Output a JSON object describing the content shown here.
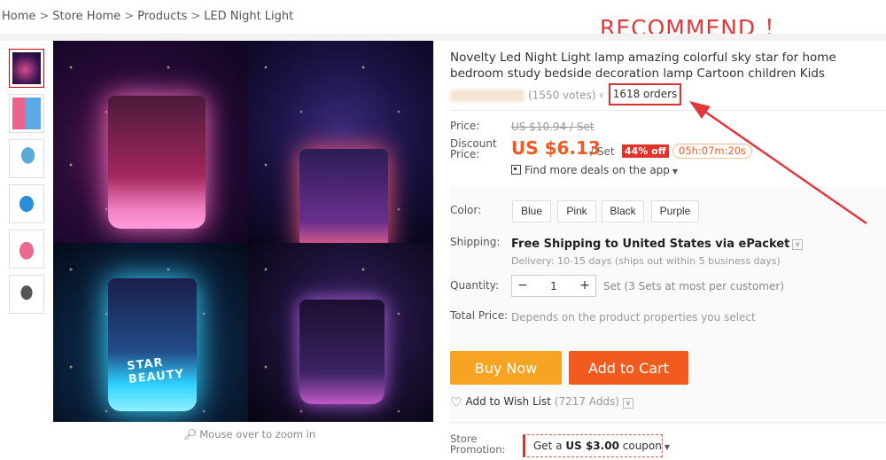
{
  "breadcrumb": [
    "Home",
    "Store Home",
    "Products",
    "LED Night Light"
  ],
  "breadcrumb_sep": ">",
  "annotation": {
    "text": "RECOMMEND ！",
    "color": "#e0373b"
  },
  "gallery": {
    "thumbnails": [
      "lamp-galaxy-thumb",
      "lamp-boxes-thumb",
      "lamp-blue-dark-thumb",
      "lamp-blue-thumb",
      "lamp-pink-thumb",
      "lamp-parts-thumb"
    ],
    "lamp_label": "STAR BEAUTY",
    "zoom_hint": "Mouse over to zoom in"
  },
  "product": {
    "title": "Novelty Led Night Light lamp amazing colorful sky star for home bedroom study bedside decoration lamp Cartoon children Kids",
    "votes": "(1550 votes)",
    "orders": "1618 orders"
  },
  "pricing": {
    "price_label": "Price:",
    "original_price": "US $10.94 / Set",
    "discount_label_1": "Discount",
    "discount_label_2": "Price:",
    "discount_price": "US $6.13",
    "per_unit": "/ Set",
    "off_badge": "44% off",
    "countdown": "05h:07m:20s",
    "app_deal": "Find more deals on the app",
    "accent_color": "#f05a22"
  },
  "options": {
    "color_label": "Color:",
    "colors": [
      "Blue",
      "Pink",
      "Black",
      "Purple"
    ],
    "shipping_label": "Shipping:",
    "shipping_main": "Free Shipping to United States via ePacket",
    "shipping_sub": "Delivery: 10-15 days (ships out within 5 business days)",
    "quantity_label": "Quantity:",
    "quantity_value": "1",
    "quantity_note": "Set (3 Sets at most per customer)",
    "total_label": "Total Price:",
    "total_value": "Depends on the product properties you select"
  },
  "actions": {
    "buy_now": "Buy Now",
    "add_to_cart": "Add to Cart",
    "wish_list": "Add to Wish List",
    "wish_count": "(7217 Adds)"
  },
  "promotion": {
    "label_1": "Store",
    "label_2": "Promotion:",
    "coupon_prefix": "Get a",
    "coupon_amount": "US $3.00",
    "coupon_suffix": "coupon"
  }
}
